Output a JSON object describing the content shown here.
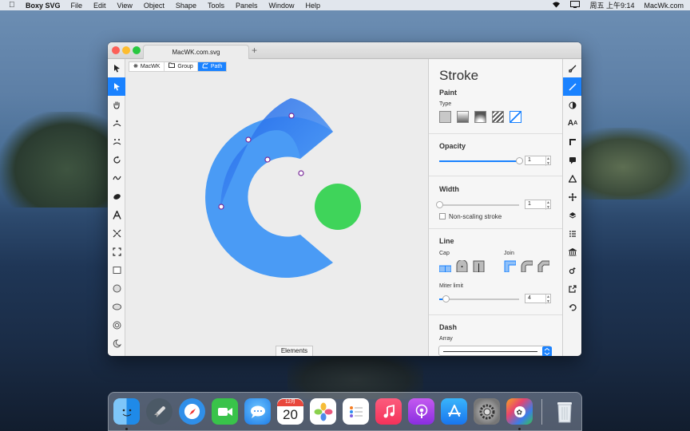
{
  "menubar": {
    "apple": "",
    "app_name": "Boxy SVG",
    "items": [
      "File",
      "Edit",
      "View",
      "Object",
      "Shape",
      "Tools",
      "Panels",
      "Window",
      "Help"
    ],
    "clock": "周五 上午9:14",
    "site": "MacWk.com"
  },
  "window": {
    "tab_title": "MacWK.com.svg",
    "new_tab": "+"
  },
  "breadcrumb": [
    {
      "label": "MacWK",
      "icon": "gear-icon"
    },
    {
      "label": "Group",
      "icon": "folder-icon"
    },
    {
      "label": "Path",
      "icon": "path-icon"
    }
  ],
  "canvas": {
    "elements_label": "Elements",
    "logo_blue": "#4a9bf5",
    "logo_green": "#3fd45a"
  },
  "inspector": {
    "title": "Stroke",
    "paint": {
      "label": "Paint",
      "type_label": "Type"
    },
    "opacity": {
      "label": "Opacity",
      "value": "1",
      "level": 1.0
    },
    "width": {
      "label": "Width",
      "value": "1",
      "level": 0.0,
      "nonscaling_label": "Non-scaling stroke"
    },
    "line": {
      "label": "Line",
      "cap_label": "Cap",
      "join_label": "Join",
      "miter_label": "Miter limit",
      "miter_value": "4",
      "miter_level": 0.08
    },
    "dash": {
      "label": "Dash",
      "array_label": "Array"
    }
  },
  "colors": {
    "accent": "#1a82ff"
  }
}
